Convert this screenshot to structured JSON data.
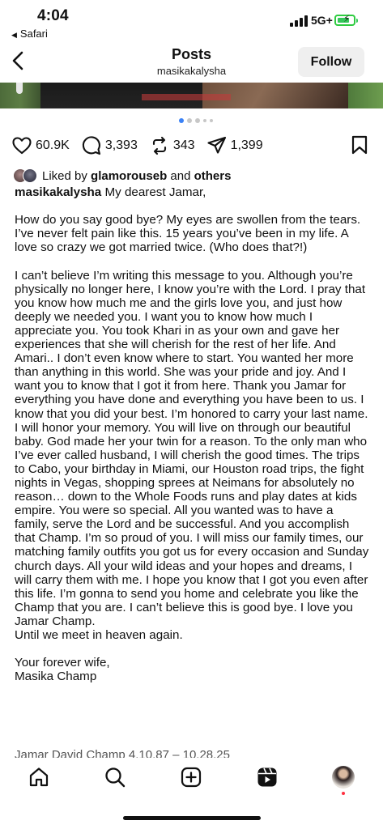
{
  "status_bar": {
    "time": "4:04",
    "back_app": "Safari",
    "network": "5G+",
    "battery_color": "#34c759"
  },
  "header": {
    "title": "Posts",
    "username": "masikakalysha",
    "follow_label": "Follow"
  },
  "carousel": {
    "total": 5,
    "active_index": 0
  },
  "actions": {
    "likes": "60.9K",
    "comments": "3,393",
    "reposts": "343",
    "shares": "1,399"
  },
  "liked_by": {
    "prefix": "Liked by",
    "user": "glamorouseb",
    "conj": "and",
    "others": "others"
  },
  "caption": {
    "author": "masikakalysha",
    "paragraphs": [
      "My dearest Jamar,",
      "",
      "How do you say good bye? My eyes are swollen from the tears. I’ve never felt pain like this. 15 years you’ve been in my life. A love so crazy we got married twice. (Who does that?!)",
      "",
      "I can’t believe I’m writing this message to you. Although you’re physically no longer here, I know you’re with the Lord. I pray that you know how much me and the girls love you, and just how deeply we needed you. I want you to know how much I appreciate you. You took Khari in as your own and gave her experiences that she will cherish for the rest of her life. And Amari.. I don’t even know where to start. You wanted her more than anything in this world. She was your pride and joy. And I want you to know that I got it from here. Thank you Jamar for everything you have done and everything you have been to us. I know that you did your best. I’m honored to carry your last name. I will honor your memory. You will live on through our beautiful baby. God made her your twin for a reason. To the only man who I’ve ever called husband, I will cherish the good times. The trips to Cabo, your birthday in Miami, our Houston road trips, the fight nights in Vegas, shopping sprees at Neimans for absolutely no reason… down to the Whole Foods runs and play dates at kids empire. You were so special. All you wanted was to have a family, serve the Lord and be successful. And you accomplish that Champ. I’m so proud of you. I will miss our family times, our matching family outfits you got us for every occasion and Sunday church days. All your wild ideas and your hopes and dreams, I will carry them with me. I hope you know that I got you even after this life. I’m gonna to send you home and celebrate you like the Champ that you are. I can’t believe this is good bye. I love you Jamar Champ.",
      "Until we meet in heaven again.",
      "",
      "Your forever wife,",
      "Masika Champ"
    ],
    "cutoff_line": "Jamar David Champ 4.10.87 – 10.28.25"
  },
  "tabbar": {
    "items": [
      "home-icon",
      "search-icon",
      "create-icon",
      "reels-icon",
      "profile"
    ]
  }
}
